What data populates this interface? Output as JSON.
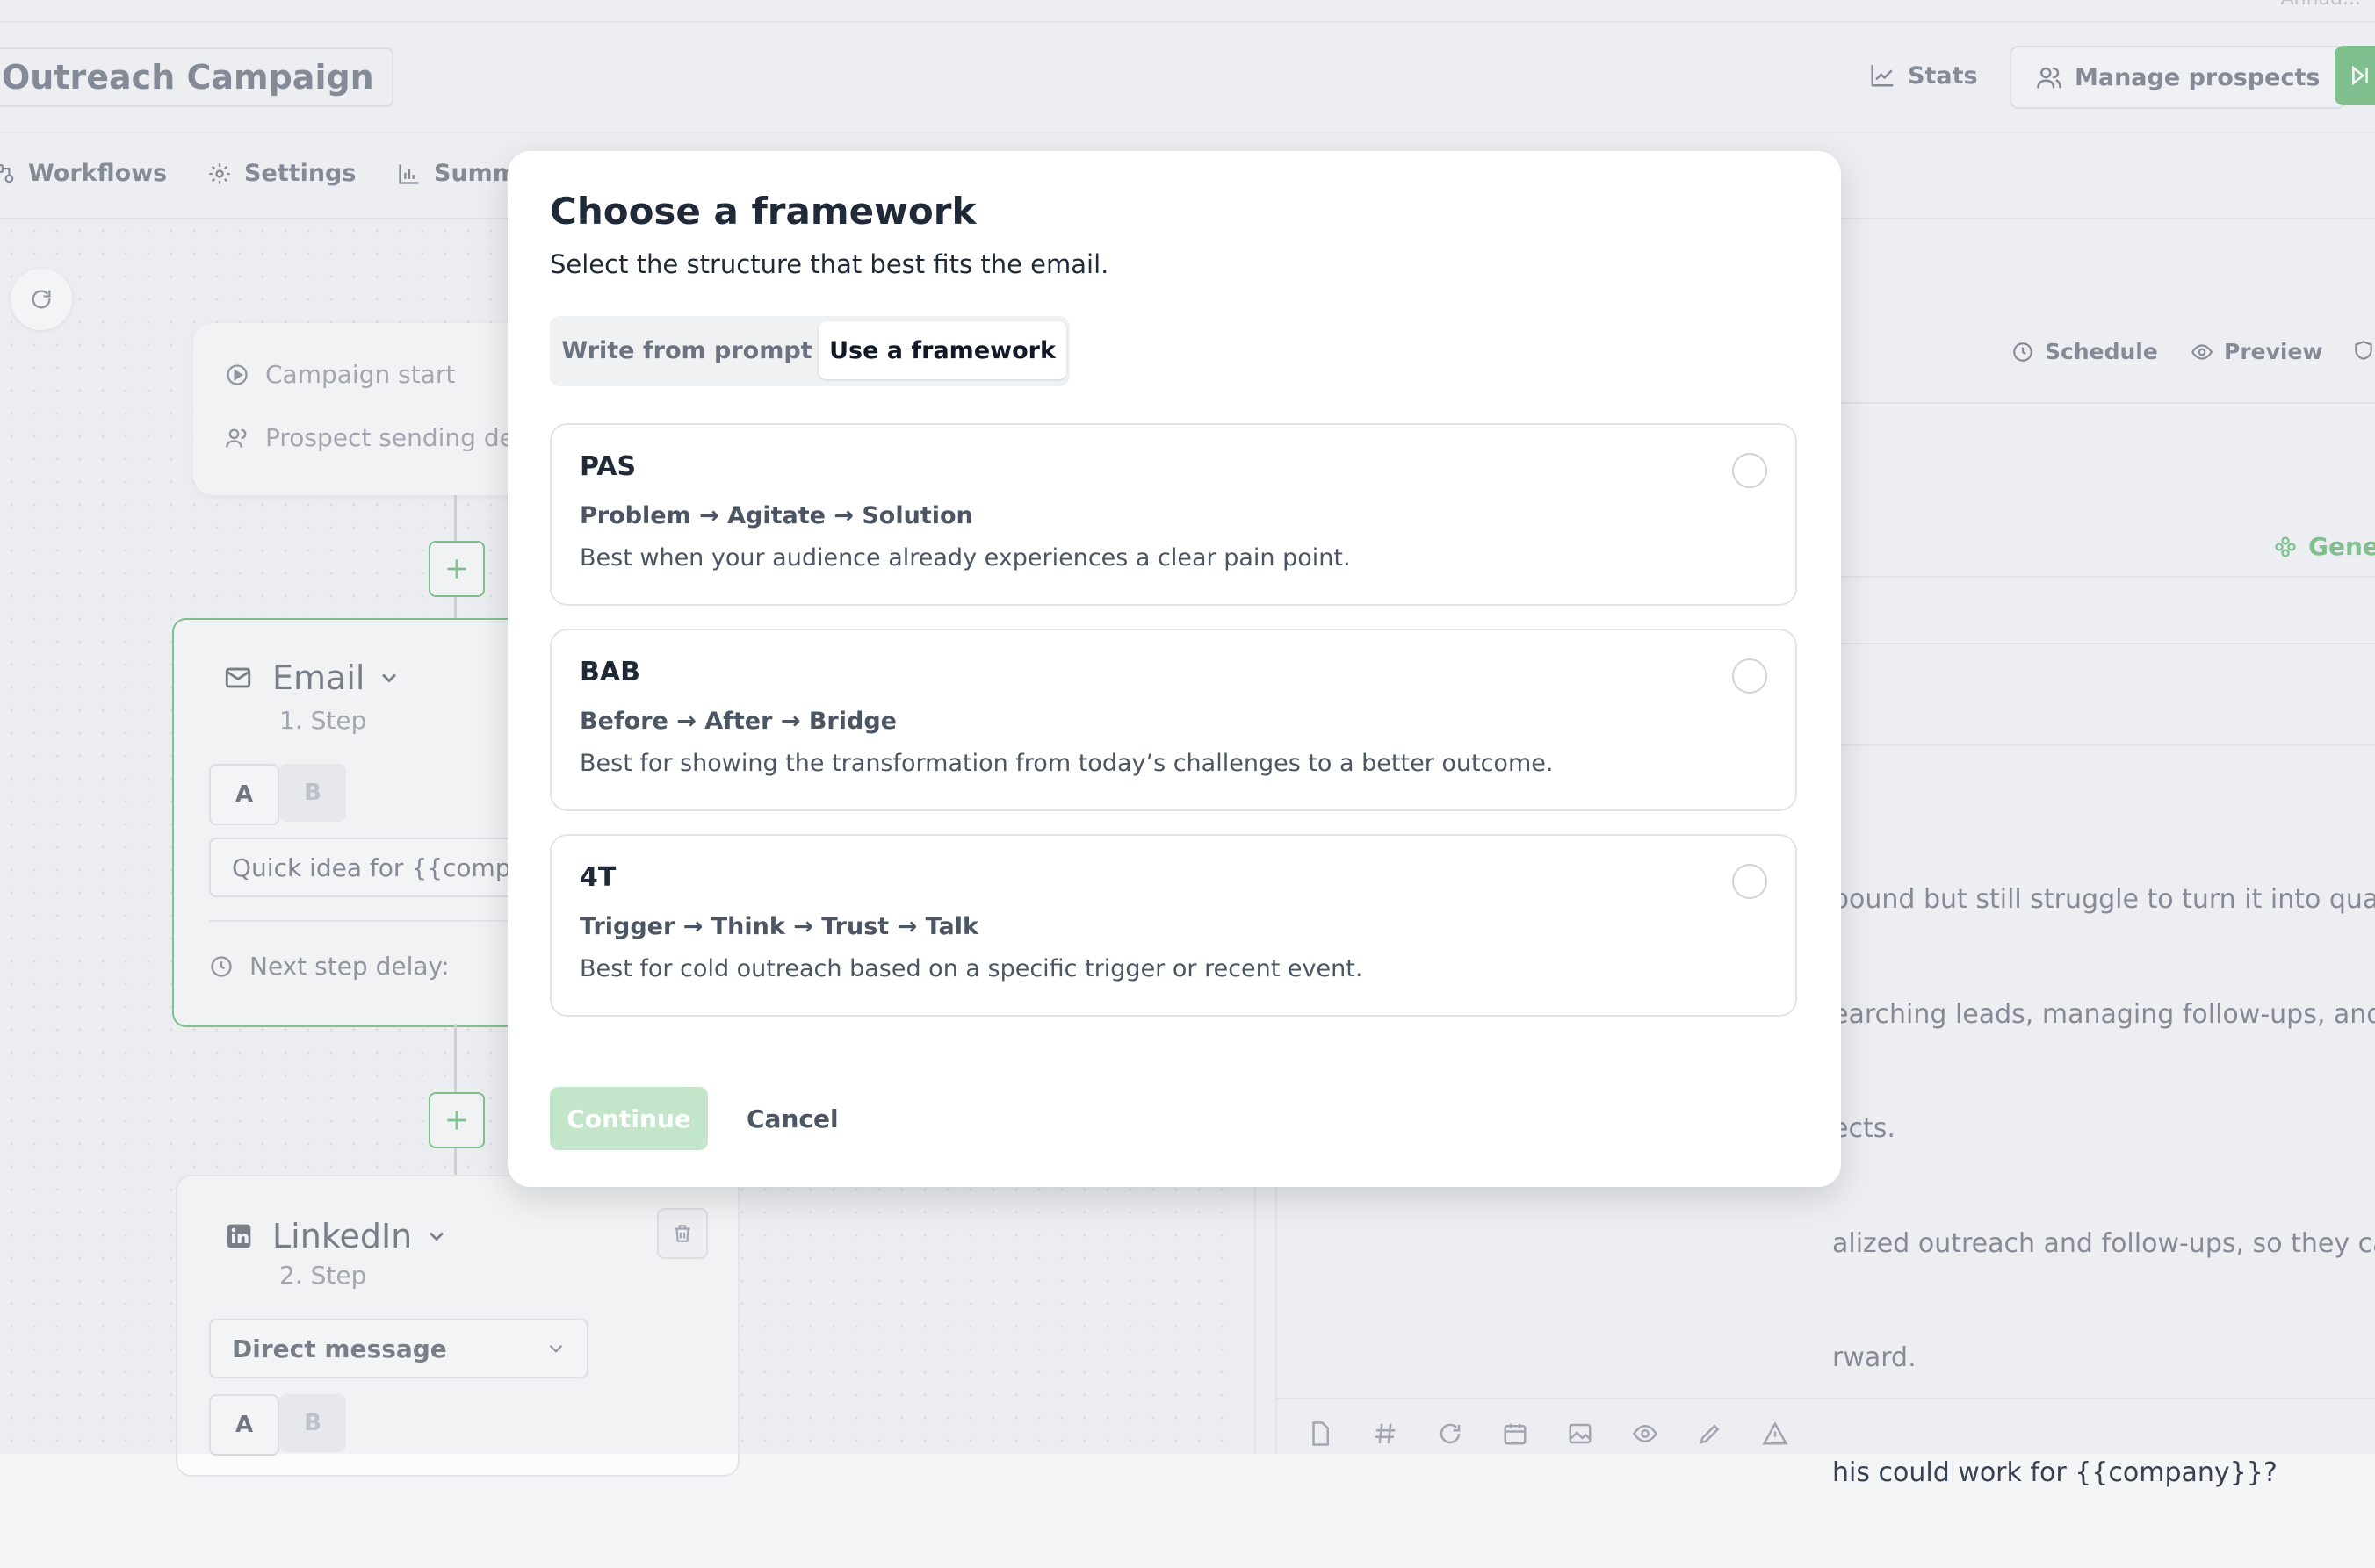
{
  "header": {
    "user_name": "Ahnad...",
    "campaign_title": "Outreach Campaign",
    "stats_label": "Stats",
    "manage_label": "Manage prospects"
  },
  "subnav": {
    "workflows": "Workflows",
    "settings": "Settings",
    "summary": "Summ"
  },
  "workflow": {
    "start_items": [
      "Campaign start",
      "Prospect sending del"
    ],
    "email_step": {
      "title": "Email",
      "step": "1. Step",
      "variant_a": "A",
      "variant_b": "B",
      "subject": "Quick idea for {{compa",
      "delay_label": "Next step delay:"
    },
    "linkedin_step": {
      "title": "LinkedIn",
      "step": "2. Step",
      "action": "Direct message",
      "variant_a": "A",
      "variant_b": "B"
    }
  },
  "editor": {
    "schedule": "Schedule",
    "preview": "Preview",
    "generate": "Gener",
    "body_lines": [
      "bound but still struggle to turn it into qualifie",
      "earching leads, managing follow-ups, and u",
      "ects.",
      "alized outreach and follow-ups, so they can",
      "rward.",
      "his could work for {{company}}?"
    ]
  },
  "modal": {
    "title": "Choose a framework",
    "subtitle": "Select the structure that best fits the email.",
    "tabs": {
      "prompt": "Write from prompt",
      "framework": "Use a framework",
      "active": "framework"
    },
    "frameworks": [
      {
        "name": "PAS",
        "steps": "Problem → Agitate → Solution",
        "desc": "Best when your audience already experiences a clear pain point."
      },
      {
        "name": "BAB",
        "steps": "Before → After → Bridge",
        "desc": "Best for showing the transformation from today’s challenges to a better outcome."
      },
      {
        "name": "4T",
        "steps": "Trigger → Think → Trust → Talk",
        "desc": "Best for cold outreach based on a specific trigger or recent event."
      }
    ],
    "continue_label": "Continue",
    "cancel_label": "Cancel"
  },
  "colors": {
    "accent": "#2ea043",
    "accent_disabled": "#c3e6cb",
    "text": "#1f2937",
    "muted": "#6b7280"
  }
}
